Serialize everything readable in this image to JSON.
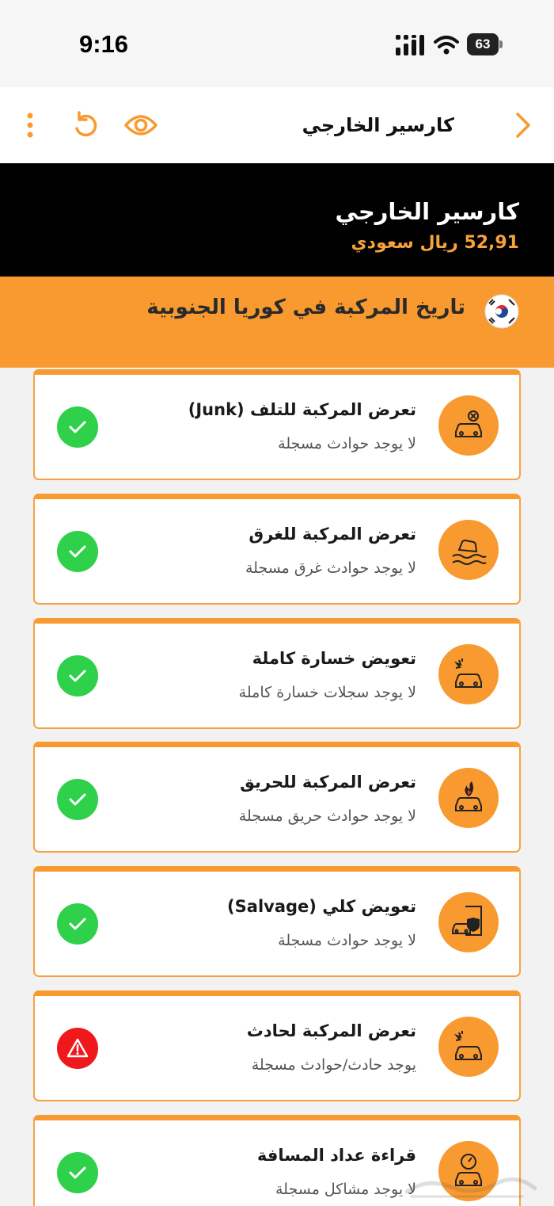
{
  "status_bar": {
    "time": "9:16",
    "battery": "63"
  },
  "nav": {
    "title": "كارسير الخارجي",
    "icons": [
      "more-vertical-icon",
      "refresh-icon",
      "eye-icon",
      "chevron-right-icon"
    ]
  },
  "header": {
    "title": "كارسير الخارجي",
    "price": "52,91 ريال سعودي"
  },
  "banner": {
    "title": "تاريخ المركبة في كوريا الجنوبية",
    "flag_icon": "south-korea-flag-icon"
  },
  "cards": [
    {
      "title": "تعرض المركبة للتلف (Junk)",
      "subtitle": "لا يوجد حوادث مسجلة",
      "icon": "junk-car-icon",
      "status": "ok"
    },
    {
      "title": "تعرض المركبة للغرق",
      "subtitle": "لا يوجد حوادث غرق مسجلة",
      "icon": "flood-car-icon",
      "status": "ok"
    },
    {
      "title": "تعويض خسارة كاملة",
      "subtitle": "لا يوجد سجلات خسارة كاملة",
      "icon": "crash-car-icon",
      "status": "ok"
    },
    {
      "title": "تعرض المركبة للحريق",
      "subtitle": "لا يوجد حوادث حريق مسجلة",
      "icon": "fire-car-icon",
      "status": "ok"
    },
    {
      "title": "تعويض كلي (Salvage)",
      "subtitle": "لا يوجد حوادث مسجلة",
      "icon": "salvage-document-icon",
      "status": "ok"
    },
    {
      "title": "تعرض المركبة لحادث",
      "subtitle": "يوجد حادث/حوادث مسجلة",
      "icon": "accident-car-icon",
      "status": "warn"
    },
    {
      "title": "قراءة عداد المسافة",
      "subtitle": "لا يوجد مشاكل مسجلة",
      "icon": "odometer-car-icon",
      "status": "ok"
    }
  ],
  "colors": {
    "accent": "#f89a2f",
    "ok": "#2fd04a",
    "warn": "#f0181a",
    "header_bg": "#000000"
  }
}
